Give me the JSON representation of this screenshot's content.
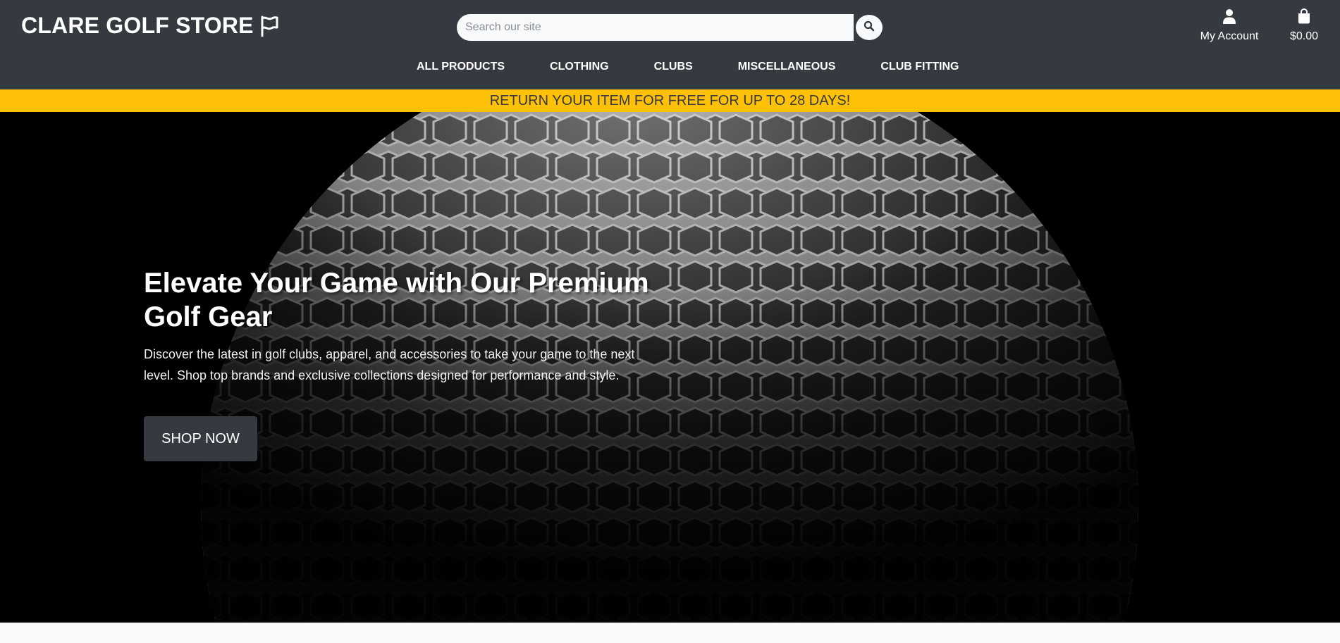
{
  "header": {
    "brand": "CLARE GOLF STORE",
    "brand_icon": "flag-icon",
    "search": {
      "placeholder": "Search our site",
      "value": "",
      "button_icon": "search-icon"
    },
    "account": {
      "label": "My Account",
      "icon": "user-icon"
    },
    "bag": {
      "label": "$0.00",
      "icon": "shopping-bag-icon"
    },
    "nav": [
      {
        "label": "ALL PRODUCTS"
      },
      {
        "label": "CLOTHING"
      },
      {
        "label": "CLUBS"
      },
      {
        "label": "MISCELLANEOUS"
      },
      {
        "label": "CLUB FITTING"
      }
    ]
  },
  "banner": {
    "text": "RETURN YOUR ITEM FOR FREE FOR UP TO 28 DAYS!"
  },
  "hero": {
    "title_line1": "Elevate Your Game with Our Premium",
    "title_line2": "Golf Gear",
    "subtitle": "Discover the latest in golf clubs, apparel, and accessories to take your game to the next level. Shop top brands and exclusive collections designed for performance and style.",
    "cta": "SHOP NOW",
    "background": "golf-ball-closeup"
  },
  "colors": {
    "header_bg": "#343a40",
    "banner_bg": "#ffc107",
    "hero_bg": "#000000",
    "text_light": "#ffffff"
  }
}
